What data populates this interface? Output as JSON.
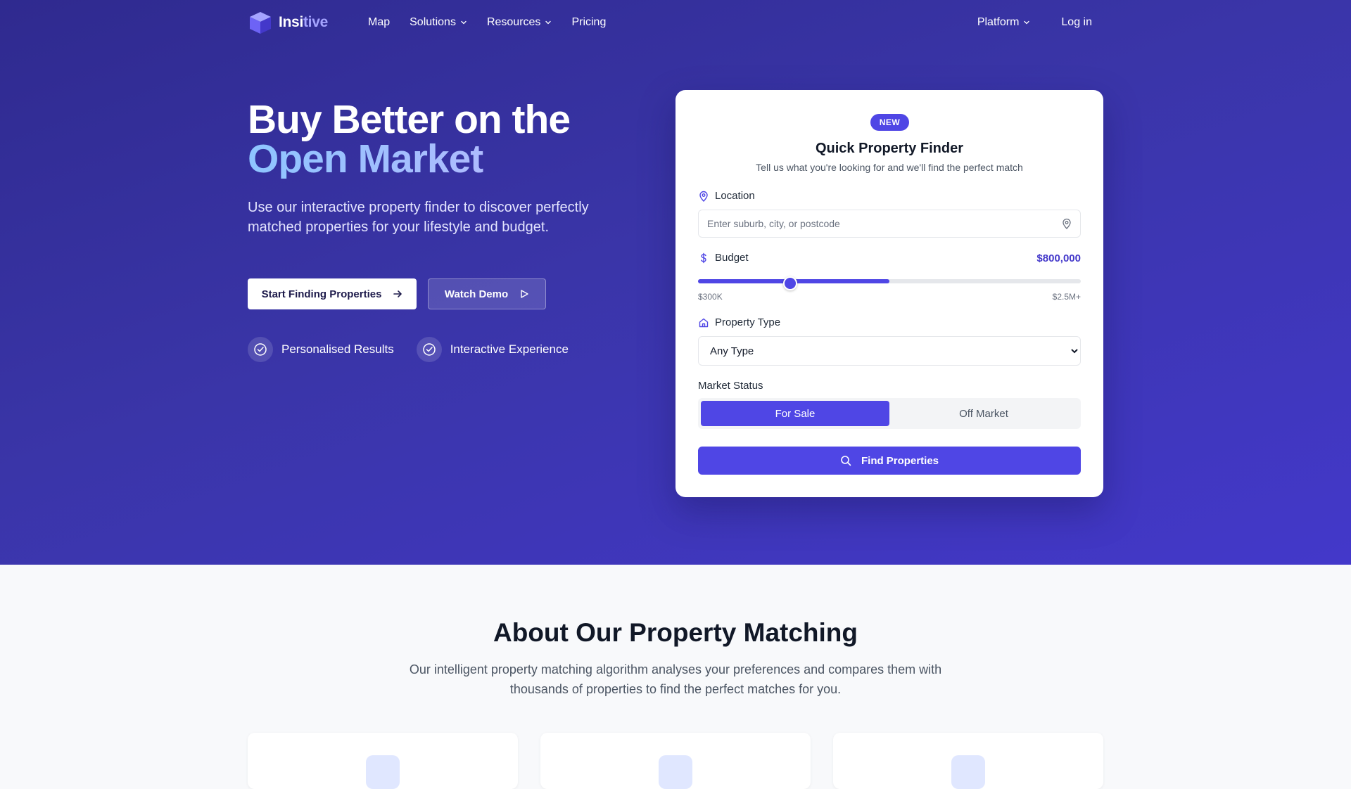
{
  "nav": {
    "logo_part1": "Insi",
    "logo_part2": "tive",
    "links": [
      {
        "label": "Map"
      },
      {
        "label": "Solutions"
      },
      {
        "label": "Resources"
      },
      {
        "label": "Pricing"
      }
    ],
    "platform_label": "Platform",
    "login_label": "Log in"
  },
  "hero": {
    "title_line1": "Buy Better on the",
    "title_line2": "Open Market",
    "subtitle": "Use our interactive property finder to discover perfectly matched properties for your lifestyle and budget.",
    "primary_button": "Start Finding Properties",
    "secondary_button": "Watch Demo",
    "features": [
      {
        "label": "Personalised Results"
      },
      {
        "label": "Interactive Experience"
      }
    ]
  },
  "finder": {
    "badge": "NEW",
    "title": "Quick Property Finder",
    "subtitle": "Tell us what you're looking for and we'll find the perfect match",
    "location_label": "Location",
    "location_placeholder": "Enter suburb, city, or postcode",
    "budget_label": "Budget",
    "budget_value": "$800,000",
    "budget_min_label": "$300K",
    "budget_max_label": "$2.5M+",
    "budget_fill_fraction": 0.5,
    "budget_thumb_fraction": 0.24,
    "property_type_label": "Property Type",
    "property_type_selected": "Any Type",
    "market_status_label": "Market Status",
    "market_status_options": [
      "For Sale",
      "Off Market"
    ],
    "market_status_selected": "For Sale",
    "find_button": "Find Properties"
  },
  "about": {
    "title": "About Our Property Matching",
    "text": "Our intelligent property matching algorithm analyses your preferences and compares them with thousands of properties to find the perfect matches for you."
  },
  "colors": {
    "hero_start": "#2f2a8f",
    "hero_end": "#4338ca",
    "accent": "#4f46e5",
    "budget_value": "#4338ca"
  },
  "icons": {
    "logo": "cube-logo-icon",
    "dropdown": "chevron-down-icon",
    "arrow": "arrow-right-icon",
    "play": "play-icon",
    "feature": "check-circle-icon",
    "location": "map-pin-icon",
    "budget": "dollar-icon",
    "property_type": "home-icon",
    "search": "search-icon"
  }
}
